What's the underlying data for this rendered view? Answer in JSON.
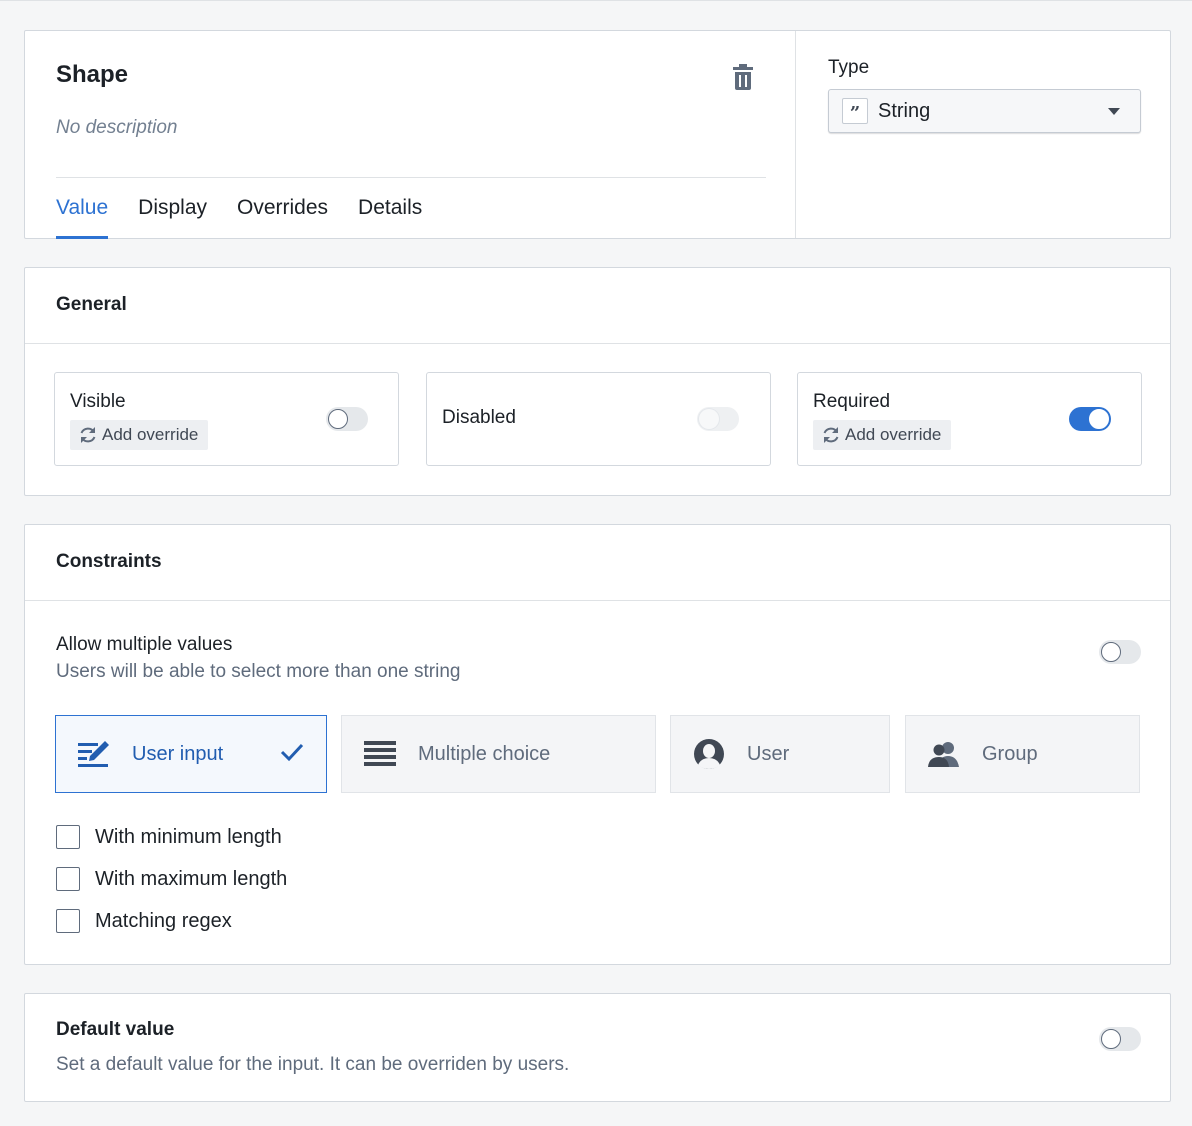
{
  "header": {
    "title": "Shape",
    "description": "No description",
    "tabs": [
      {
        "label": "Value",
        "active": true
      },
      {
        "label": "Display",
        "active": false
      },
      {
        "label": "Overrides",
        "active": false
      },
      {
        "label": "Details",
        "active": false
      }
    ],
    "type_label": "Type",
    "type_value": "String",
    "type_icon": "quote-icon"
  },
  "general": {
    "title": "General",
    "items": [
      {
        "label": "Visible",
        "override": "Add override",
        "toggle": false,
        "disabled": false
      },
      {
        "label": "Disabled",
        "toggle": false,
        "disabled": true
      },
      {
        "label": "Required",
        "override": "Add override",
        "toggle": true,
        "disabled": false
      }
    ]
  },
  "constraints": {
    "title": "Constraints",
    "multiple_title": "Allow multiple values",
    "multiple_desc": "Users will be able to select more than one string",
    "multiple_toggle": false,
    "options": [
      {
        "label": "User input",
        "icon": "edit-icon",
        "selected": true
      },
      {
        "label": "Multiple choice",
        "icon": "list-icon",
        "selected": false
      },
      {
        "label": "User",
        "icon": "person-icon",
        "selected": false
      },
      {
        "label": "Group",
        "icon": "people-icon",
        "selected": false
      }
    ],
    "checkboxes": [
      {
        "label": "With minimum length",
        "checked": false
      },
      {
        "label": "With maximum length",
        "checked": false
      },
      {
        "label": "Matching regex",
        "checked": false
      }
    ]
  },
  "default_value": {
    "title": "Default value",
    "desc": "Set a default value for the input. It can be overriden by users.",
    "toggle": false
  },
  "colors": {
    "accent": "#2d72d2",
    "background": "#f5f6f7",
    "text": "#1c2127",
    "muted": "#5f6b7c"
  }
}
